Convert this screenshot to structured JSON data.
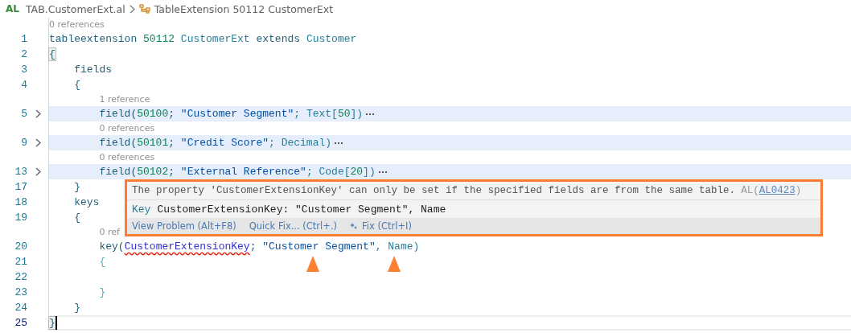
{
  "breadcrumb": {
    "language": "AL",
    "file": "TAB.CustomerExt.al",
    "symbol": "TableExtension 50112 CustomerExt"
  },
  "rows": [
    {
      "kind": "lens",
      "text": "0 references"
    },
    {
      "kind": "line",
      "number": "1",
      "folded": false,
      "current": false,
      "tokens": [
        {
          "text": "tableextension ",
          "kind": "kw"
        },
        {
          "text": "50112",
          "kind": "num"
        },
        {
          "text": " CustomerExt ",
          "kind": "name"
        },
        {
          "text": "extends",
          "kind": "kw"
        },
        {
          "text": " Customer",
          "kind": "name"
        }
      ]
    },
    {
      "kind": "line",
      "number": "2",
      "folded": false,
      "current": false,
      "tokens": [
        {
          "text": "{",
          "kind": "match"
        }
      ]
    },
    {
      "kind": "line",
      "number": "3",
      "folded": false,
      "current": false,
      "tokens": [
        {
          "text": "    fields",
          "kind": "kw"
        }
      ]
    },
    {
      "kind": "line",
      "number": "4",
      "folded": false,
      "current": false,
      "tokens": [
        {
          "text": "    {",
          "kind": "kw"
        }
      ]
    },
    {
      "kind": "lens",
      "text": "1 reference"
    },
    {
      "kind": "line",
      "number": "5",
      "folded": true,
      "current": false,
      "tokens": [
        {
          "text": "        field(",
          "kind": "kw"
        },
        {
          "text": "50100",
          "kind": "num"
        },
        {
          "text": "; ",
          "kind": "kw"
        },
        {
          "text": "\"Customer Segment\"",
          "kind": "str"
        },
        {
          "text": "; Text[",
          "kind": "name"
        },
        {
          "text": "50",
          "kind": "num"
        },
        {
          "text": "])",
          "kind": "name"
        }
      ]
    },
    {
      "kind": "lens",
      "text": "0 references"
    },
    {
      "kind": "line",
      "number": "9",
      "folded": true,
      "current": false,
      "tokens": [
        {
          "text": "        field(",
          "kind": "kw"
        },
        {
          "text": "50101",
          "kind": "num"
        },
        {
          "text": "; ",
          "kind": "kw"
        },
        {
          "text": "\"Credit Score\"",
          "kind": "str"
        },
        {
          "text": "; Decimal)",
          "kind": "name"
        }
      ]
    },
    {
      "kind": "lens",
      "text": "0 references"
    },
    {
      "kind": "line",
      "number": "13",
      "folded": true,
      "current": false,
      "tokens": [
        {
          "text": "        field(",
          "kind": "kw"
        },
        {
          "text": "50102",
          "kind": "num"
        },
        {
          "text": "; ",
          "kind": "kw"
        },
        {
          "text": "\"External Reference\"",
          "kind": "str"
        },
        {
          "text": "; Code[",
          "kind": "name"
        },
        {
          "text": "20",
          "kind": "num"
        },
        {
          "text": "])",
          "kind": "name"
        }
      ]
    },
    {
      "kind": "line",
      "number": "17",
      "folded": false,
      "current": false,
      "tokens": [
        {
          "text": "    }",
          "kind": "kw"
        }
      ]
    },
    {
      "kind": "line",
      "number": "18",
      "folded": false,
      "current": false,
      "tokens": [
        {
          "text": "    keys",
          "kind": "kw"
        }
      ]
    },
    {
      "kind": "line",
      "number": "19",
      "folded": false,
      "current": false,
      "tokens": [
        {
          "text": "    {",
          "kind": "kw"
        }
      ]
    },
    {
      "kind": "lens",
      "text": "0 ref"
    },
    {
      "kind": "line",
      "number": "20",
      "folded": false,
      "current": false,
      "tokens": [
        {
          "text": "        key(",
          "kind": "kw"
        },
        {
          "text": "CustomerExtensionKey",
          "kind": "error"
        },
        {
          "text": "; ",
          "kind": "kw"
        },
        {
          "text": "\"Customer Segment\"",
          "kind": "str"
        },
        {
          "text": ", Name)",
          "kind": "name"
        }
      ]
    },
    {
      "kind": "line",
      "number": "21",
      "folded": false,
      "current": false,
      "tokens": [
        {
          "text": "        {",
          "kind": "brace"
        }
      ]
    },
    {
      "kind": "line",
      "number": "22",
      "folded": false,
      "current": false,
      "tokens": []
    },
    {
      "kind": "line",
      "number": "23",
      "folded": false,
      "current": false,
      "tokens": [
        {
          "text": "        }",
          "kind": "brace"
        }
      ]
    },
    {
      "kind": "line",
      "number": "24",
      "folded": false,
      "current": false,
      "tokens": [
        {
          "text": "    }",
          "kind": "kw"
        }
      ]
    },
    {
      "kind": "line",
      "number": "25",
      "folded": false,
      "current": true,
      "tokens": [
        {
          "text": "}",
          "kind": "match"
        }
      ]
    }
  ],
  "popup": {
    "message": "The property 'CustomerExtensionKey' can only be set if the specified fields are from the same table.",
    "source": "AL(",
    "code": "AL0423",
    "source_end": ")",
    "key_label": "Key",
    "key_text": "CustomerExtensionKey: \"Customer Segment\", Name",
    "actions": [
      {
        "label": "View Problem (Alt+F8)",
        "kind": "plain"
      },
      {
        "label": "Quick Fix... (Ctrl+.)",
        "kind": "plain"
      },
      {
        "label": "Fix (Ctrl+I)",
        "kind": "sparkle"
      }
    ]
  }
}
